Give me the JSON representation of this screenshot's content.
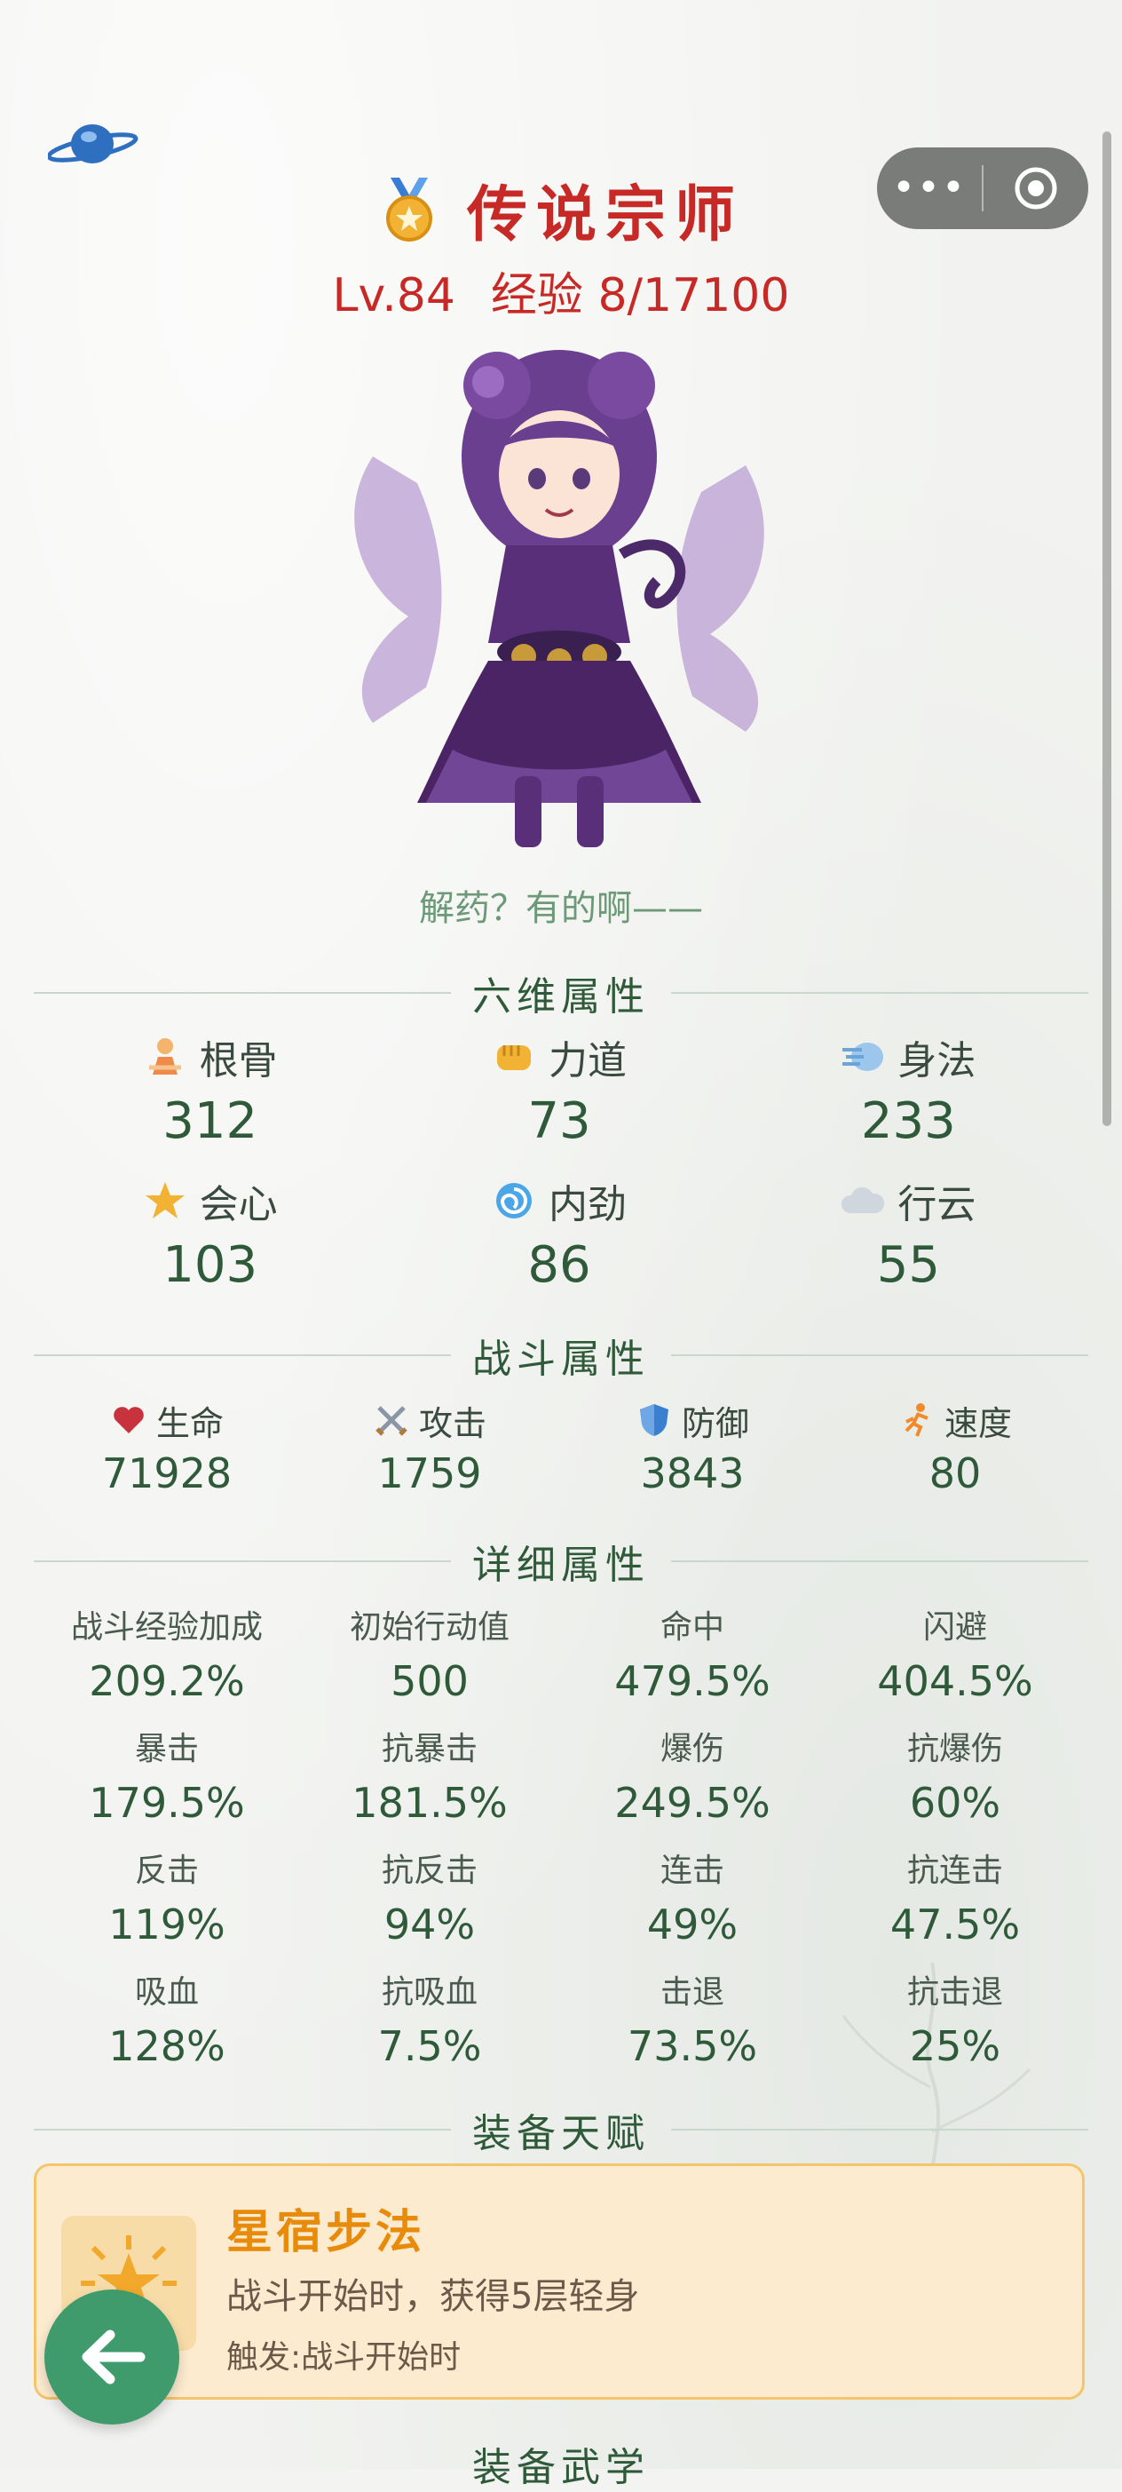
{
  "header": {
    "rank_title": "传说宗师",
    "level": "Lv.84",
    "exp": "经验 8/17100",
    "quote": "解药？有的啊——",
    "capsule_more": "•••"
  },
  "six_stats": {
    "section_title": "六维属性",
    "items": [
      {
        "icon": "person-icon",
        "label": "根骨",
        "value": "312"
      },
      {
        "icon": "fist-icon",
        "label": "力道",
        "value": "73"
      },
      {
        "icon": "wind-icon",
        "label": "身法",
        "value": "233"
      },
      {
        "icon": "star-icon",
        "label": "会心",
        "value": "103"
      },
      {
        "icon": "swirl-icon",
        "label": "内劲",
        "value": "86"
      },
      {
        "icon": "cloud-icon",
        "label": "行云",
        "value": "55"
      }
    ]
  },
  "battle_stats": {
    "section_title": "战斗属性",
    "items": [
      {
        "icon": "heart-icon",
        "label": "生命",
        "value": "71928"
      },
      {
        "icon": "swords-icon",
        "label": "攻击",
        "value": "1759"
      },
      {
        "icon": "shield-icon",
        "label": "防御",
        "value": "3843"
      },
      {
        "icon": "runner-icon",
        "label": "速度",
        "value": "80"
      }
    ]
  },
  "detail_stats": {
    "section_title": "详细属性",
    "items": [
      {
        "label": "战斗经验加成",
        "value": "209.2%"
      },
      {
        "label": "初始行动值",
        "value": "500"
      },
      {
        "label": "命中",
        "value": "479.5%"
      },
      {
        "label": "闪避",
        "value": "404.5%"
      },
      {
        "label": "暴击",
        "value": "179.5%"
      },
      {
        "label": "抗暴击",
        "value": "181.5%"
      },
      {
        "label": "爆伤",
        "value": "249.5%"
      },
      {
        "label": "抗爆伤",
        "value": "60%"
      },
      {
        "label": "反击",
        "value": "119%"
      },
      {
        "label": "抗反击",
        "value": "94%"
      },
      {
        "label": "连击",
        "value": "49%"
      },
      {
        "label": "抗连击",
        "value": "47.5%"
      },
      {
        "label": "吸血",
        "value": "128%"
      },
      {
        "label": "抗吸血",
        "value": "7.5%"
      },
      {
        "label": "击退",
        "value": "73.5%"
      },
      {
        "label": "抗击退",
        "value": "25%"
      }
    ]
  },
  "talent": {
    "section_title": "装备天赋",
    "name": "星宿步法",
    "description": "战斗开始时，获得5层轻身",
    "trigger": "触发:战斗开始时"
  },
  "martial": {
    "section_title": "装备武学"
  },
  "colors": {
    "accent_red": "#c72a26",
    "stat_green": "#2f5a3a",
    "talent_orange": "#e88a0a",
    "back_button": "#3f9a6c"
  }
}
